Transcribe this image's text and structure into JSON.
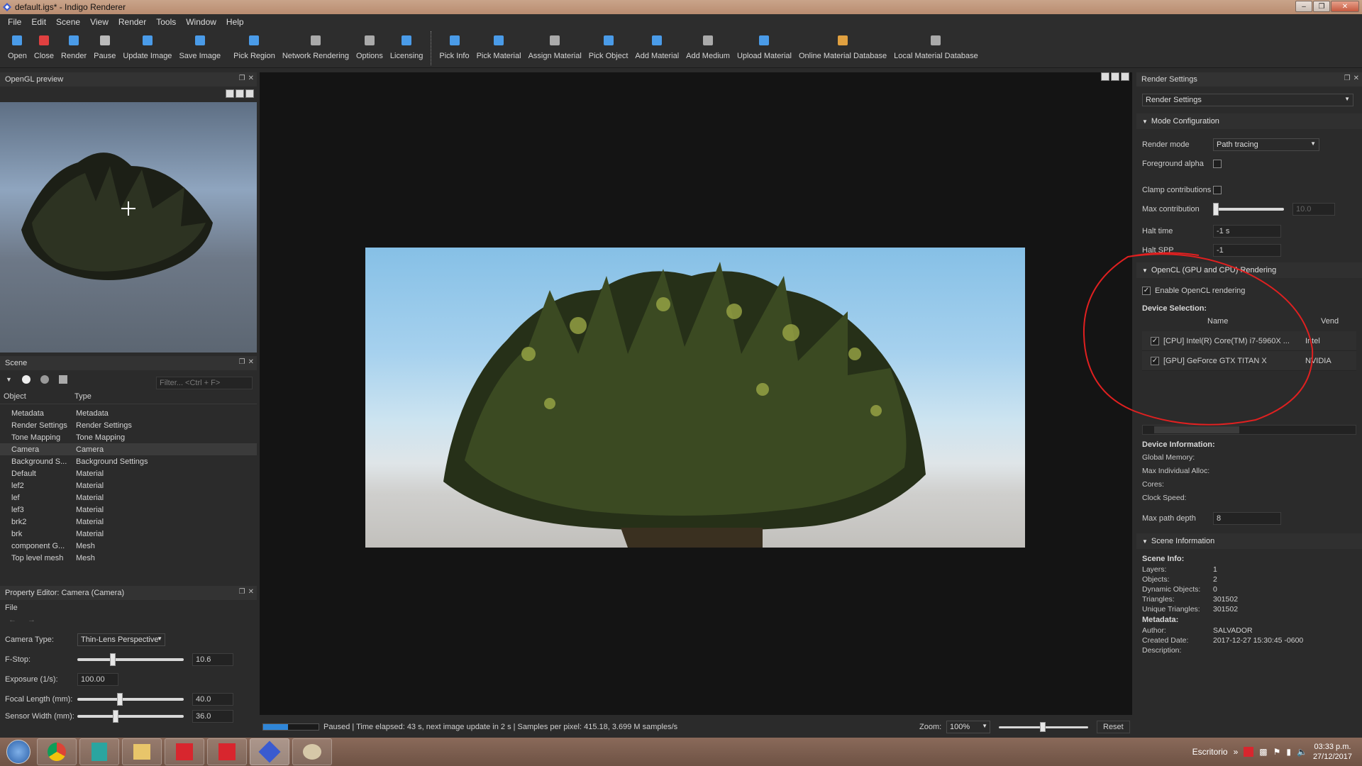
{
  "window": {
    "title": "default.igs* - Indigo Renderer"
  },
  "menubar": [
    "File",
    "Edit",
    "Scene",
    "View",
    "Render",
    "Tools",
    "Window",
    "Help"
  ],
  "toolbar": [
    {
      "label": "Open",
      "icon": "plus-icon",
      "color": "#4a9be8"
    },
    {
      "label": "Close",
      "icon": "close-icon",
      "color": "#e04040"
    },
    {
      "label": "Render",
      "icon": "play-icon",
      "color": "#4a9be8"
    },
    {
      "label": "Pause",
      "icon": "pause-icon",
      "color": "#bbbbbb"
    },
    {
      "label": "Update Image",
      "icon": "refresh-icon",
      "color": "#4a9be8"
    },
    {
      "label": "Save Image",
      "icon": "save-icon",
      "color": "#4a9be8"
    },
    {
      "label": "Pick Region",
      "icon": "region-icon",
      "color": "#4a9be8"
    },
    {
      "label": "Network Rendering",
      "icon": "network-icon",
      "color": "#aaaaaa"
    },
    {
      "label": "Options",
      "icon": "gear-icon",
      "color": "#aaaaaa"
    },
    {
      "label": "Licensing",
      "icon": "key-icon",
      "color": "#4a9be8"
    },
    {
      "label": "Pick Info",
      "icon": "chart-icon",
      "color": "#4a9be8"
    },
    {
      "label": "Pick Material",
      "icon": "material-icon",
      "color": "#4a9be8"
    },
    {
      "label": "Assign Material",
      "icon": "bucket-icon",
      "color": "#aaaaaa"
    },
    {
      "label": "Pick Object",
      "icon": "object-icon",
      "color": "#4a9be8"
    },
    {
      "label": "Add Material",
      "icon": "add-material-icon",
      "color": "#4a9be8"
    },
    {
      "label": "Add Medium",
      "icon": "medium-icon",
      "color": "#aaaaaa"
    },
    {
      "label": "Upload Material",
      "icon": "upload-icon",
      "color": "#4a9be8"
    },
    {
      "label": "Online Material Database",
      "icon": "database-online-icon",
      "color": "#e0a040"
    },
    {
      "label": "Local Material Database",
      "icon": "database-local-icon",
      "color": "#aaaaaa"
    }
  ],
  "opengl_panel": {
    "title": "OpenGL preview"
  },
  "scene_panel": {
    "title": "Scene",
    "filter_placeholder": "Filter... <Ctrl + F>",
    "col_object": "Object",
    "col_type": "Type",
    "rows": [
      {
        "object": "Metadata",
        "type": "Metadata"
      },
      {
        "object": "Render Settings",
        "type": "Render Settings"
      },
      {
        "object": "Tone Mapping",
        "type": "Tone Mapping"
      },
      {
        "object": "Camera",
        "type": "Camera"
      },
      {
        "object": "Background S...",
        "type": "Background Settings"
      },
      {
        "object": "Default",
        "type": "Material"
      },
      {
        "object": "lef2",
        "type": "Material"
      },
      {
        "object": "lef",
        "type": "Material"
      },
      {
        "object": "lef3",
        "type": "Material"
      },
      {
        "object": "brk2",
        "type": "Material"
      },
      {
        "object": "brk",
        "type": "Material"
      },
      {
        "object": "component G...",
        "type": "Mesh"
      },
      {
        "object": "Top level mesh",
        "type": "Mesh"
      }
    ],
    "selected_index": 3
  },
  "property_editor": {
    "title": "Property Editor: Camera (Camera)",
    "menu": "File",
    "camera_type_label": "Camera Type:",
    "camera_type_value": "Thin-Lens Perspective",
    "fstop_label": "F-Stop:",
    "fstop_value": "10.6",
    "exposure_label": "Exposure (1/s):",
    "exposure_value": "100.00",
    "focal_label": "Focal Length (mm):",
    "focal_value": "40.0",
    "sensor_label": "Sensor Width (mm):",
    "sensor_value": "36.0"
  },
  "status": {
    "text": "Paused | Time elapsed: 43 s, next image update in 2 s | Samples per pixel: 415.18, 3.699 M samples/s",
    "progress": 0.45,
    "zoom_label": "Zoom:",
    "zoom_value": "100%",
    "reset_label": "Reset"
  },
  "render_settings": {
    "panel_title": "Render Settings",
    "dropdown_value": "Render Settings",
    "mode_section": "Mode Configuration",
    "render_mode_label": "Render mode",
    "render_mode_value": "Path tracing",
    "foreground_alpha_label": "Foreground alpha",
    "clamp_label": "Clamp contributions",
    "max_contribution_label": "Max contribution",
    "max_contribution_value": "10.0",
    "halt_time_label": "Halt time",
    "halt_time_value": "-1 s",
    "halt_spp_label": "Halt SPP",
    "halt_spp_value": "-1",
    "opencl_section": "OpenCL (GPU and CPU) Rendering",
    "enable_opencl_label": "Enable OpenCL rendering",
    "device_selection_label": "Device Selection:",
    "col_name": "Name",
    "col_vendor": "Vend",
    "devices": [
      {
        "name": "[CPU] Intel(R) Core(TM) i7-5960X ...",
        "vendor": "Intel"
      },
      {
        "name": "[GPU] GeForce GTX TITAN X",
        "vendor": "NVIDIA"
      }
    ],
    "device_info_label": "Device Information:",
    "global_memory_label": "Global Memory:",
    "max_alloc_label": "Max Individual Alloc:",
    "cores_label": "Cores:",
    "clock_label": "Clock Speed:",
    "max_path_depth_label": "Max path depth",
    "max_path_depth_value": "8",
    "scene_info_section": "Scene Information",
    "scene_info_label": "Scene Info:",
    "scene_info": [
      {
        "k": "Layers:",
        "v": "1"
      },
      {
        "k": "Objects:",
        "v": "2"
      },
      {
        "k": "Dynamic Objects:",
        "v": "0"
      },
      {
        "k": "Triangles:",
        "v": "301502"
      },
      {
        "k": "Unique Triangles:",
        "v": "301502"
      }
    ],
    "metadata_label": "Metadata:",
    "metadata": [
      {
        "k": "Author:",
        "v": "SALVADOR"
      },
      {
        "k": "Created Date:",
        "v": "2017-12-27 15:30:45 -0600"
      },
      {
        "k": "Description:",
        "v": ""
      }
    ]
  },
  "taskbar": {
    "desktop_label": "Escritorio",
    "time": "03:33 p.m.",
    "date": "27/12/2017"
  },
  "colors": {
    "accent": "#2f86d8",
    "annotation": "#e02020"
  }
}
